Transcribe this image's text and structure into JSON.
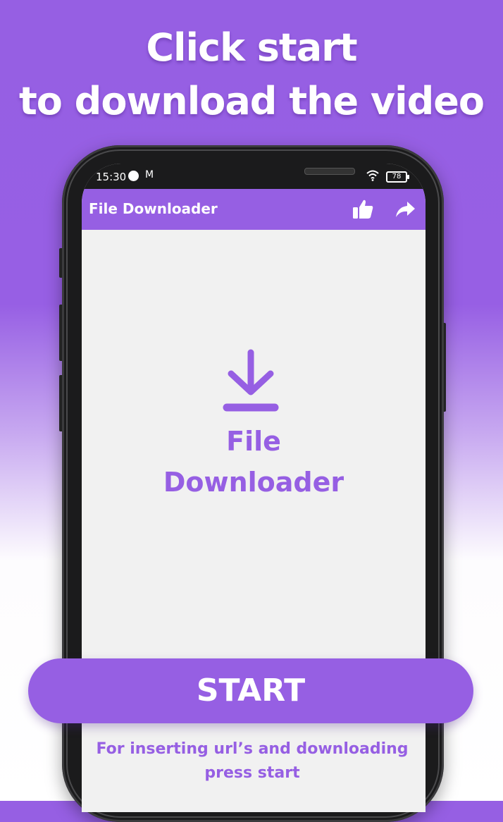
{
  "headline": {
    "line1": "Click start",
    "line2": "to download the video"
  },
  "statusbar": {
    "time": "15:30",
    "notification_icon": "gmail-icon",
    "notification_glyph": "M",
    "battery": "78"
  },
  "appbar": {
    "title": "File Downloader",
    "like_icon": "thumbs-up-icon",
    "share_icon": "share-arrow-icon"
  },
  "main": {
    "icon": "download-icon",
    "brand_line1": "File",
    "brand_line2": "Downloader"
  },
  "cta": {
    "start_label": "START",
    "hint": "For inserting url’s and downloading press start"
  },
  "colors": {
    "accent": "#965fe3",
    "screen_bg": "#f1f1f1",
    "phone_body": "#1b1b1c"
  }
}
